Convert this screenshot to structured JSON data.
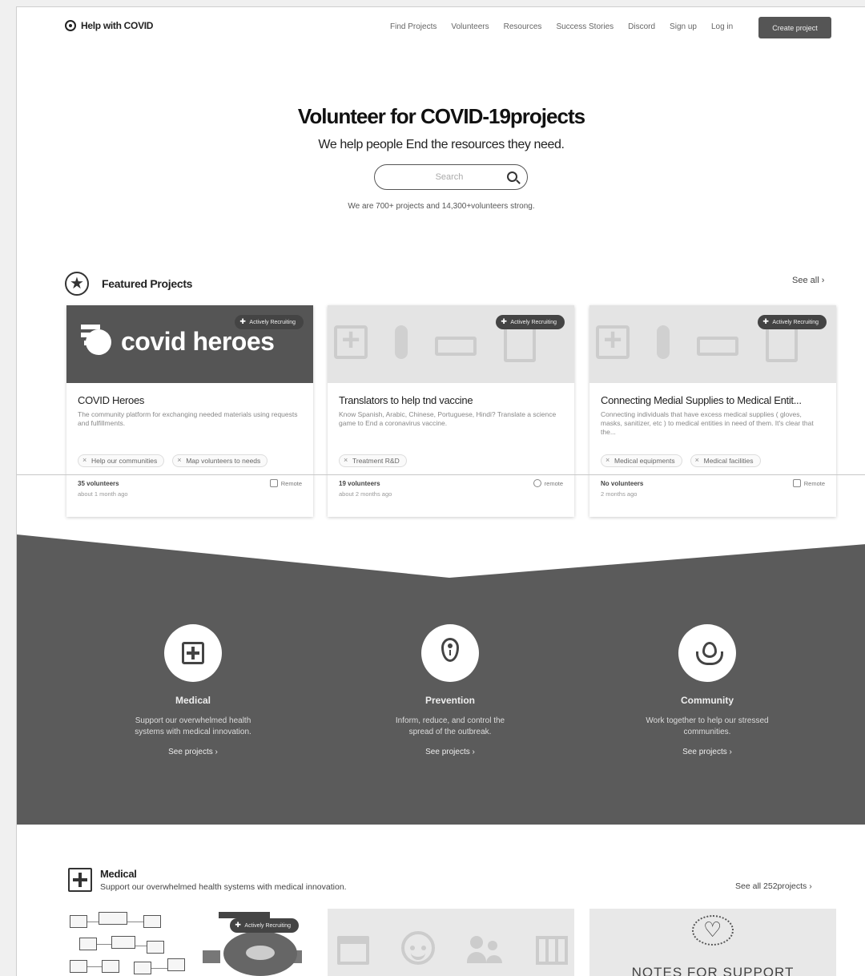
{
  "nav": {
    "logo": "Help with COVID",
    "links": [
      "Find Projects",
      "Volunteers",
      "Resources",
      "Success Stories",
      "Discord",
      "Sign up",
      "Log in"
    ],
    "cta": "Create project"
  },
  "hero": {
    "title": "Volunteer for COVID-19projects",
    "subtitle": "We help people End the resources they need.",
    "search_placeholder": "Search",
    "stats": "We are 700+ projects and 14,300+volunteers strong."
  },
  "featured": {
    "title": "Featured Projects",
    "see_all": "See all ›",
    "cards": [
      {
        "image_text": "covid heroes",
        "badge": "Actively Recruiting",
        "title": "COVID Heroes",
        "desc": "The community platform for exchanging needed materials using requests and fulfillments.",
        "tags": [
          "Help our communities",
          "Map volunteers to needs"
        ],
        "volunteers": "35 volunteers",
        "time": "about 1 month ago",
        "location": "Remote"
      },
      {
        "badge": "Actively Recruiting",
        "title": "Translators to help tnd vaccine",
        "desc": "Know Spanish, Arabic, Chinese, Portuguese, Hindi? Translate a science game to End a coronavirus vaccine.",
        "tags": [
          "Treatment R&D"
        ],
        "volunteers": "19 volunteers",
        "time": "about 2 months ago",
        "location": "remote"
      },
      {
        "badge": "Actively Recruiting",
        "title": "Connecting Medial Supplies to Medical Entit...",
        "desc": "Connecting individuals that have excess medical supplies ( gloves, masks, sanitizer, etc ) to medical entities in need of them. It's clear that the...",
        "tags": [
          "Medical equipments",
          "Medical facilities"
        ],
        "volunteers": "No volunteers",
        "time": "2 months ago",
        "location": "Remote"
      }
    ]
  },
  "categories": [
    {
      "name": "Medical",
      "icon": "medical-cross-icon",
      "desc": "Support our overwhelmed health systems with medical innovation.",
      "link": "See projects ›"
    },
    {
      "name": "Prevention",
      "icon": "location-pin-icon",
      "desc": "Inform, reduce, and control the spread of the outbreak.",
      "link": "See projects ›"
    },
    {
      "name": "Community",
      "icon": "plant-hands-icon",
      "desc": "Work together to help our stressed communities.",
      "link": "See projects ›"
    }
  ],
  "medical": {
    "title": "Medical",
    "subtitle": "Support our overwhelmed health systems with medical innovation.",
    "see_all": "See all 252projects ›",
    "card1_badge": "Actively Recruiting",
    "card3_text": "NOTES FOR SUPPORT"
  },
  "colors": {
    "band": "#5b5b5b",
    "cta": "#555555",
    "page_bg": "#ffffff"
  }
}
